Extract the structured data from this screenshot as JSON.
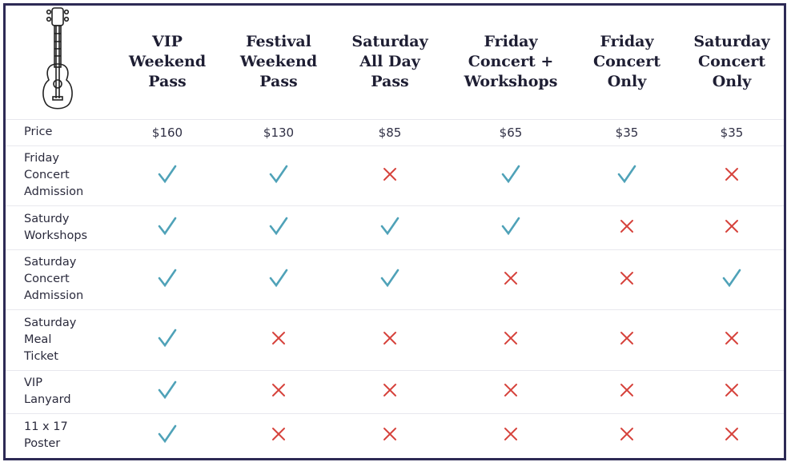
{
  "columns": [
    "VIP\nWeekend\nPass",
    "Festival\nWeekend\nPass",
    "Saturday\nAll Day\nPass",
    "Friday\nConcert +\nWorkshops",
    "Friday\nConcert\nOnly",
    "Saturday\nConcert\nOnly"
  ],
  "price_label": "Price",
  "prices": [
    "$160",
    "$130",
    "$85",
    "$65",
    "$35",
    "$35"
  ],
  "rows": [
    {
      "label": "Friday\nConcert\nAdmission",
      "values": [
        true,
        true,
        false,
        true,
        true,
        false
      ]
    },
    {
      "label": "Saturdy\nWorkshops",
      "values": [
        true,
        true,
        true,
        true,
        false,
        false
      ]
    },
    {
      "label": "Saturday\nConcert\nAdmission",
      "values": [
        true,
        true,
        true,
        false,
        false,
        true
      ]
    },
    {
      "label": "Saturday\nMeal\nTicket",
      "values": [
        true,
        false,
        false,
        false,
        false,
        false
      ]
    },
    {
      "label": "VIP\nLanyard",
      "values": [
        true,
        false,
        false,
        false,
        false,
        false
      ]
    },
    {
      "label": "11 x 17\nPoster",
      "values": [
        true,
        false,
        false,
        false,
        false,
        false
      ]
    }
  ],
  "colors": {
    "check": "#4fa2b8",
    "cross": "#d6433c",
    "border": "#2d2a55"
  },
  "icons": {
    "logo": "ukulele-icon",
    "included": "check-icon",
    "excluded": "cross-icon"
  }
}
